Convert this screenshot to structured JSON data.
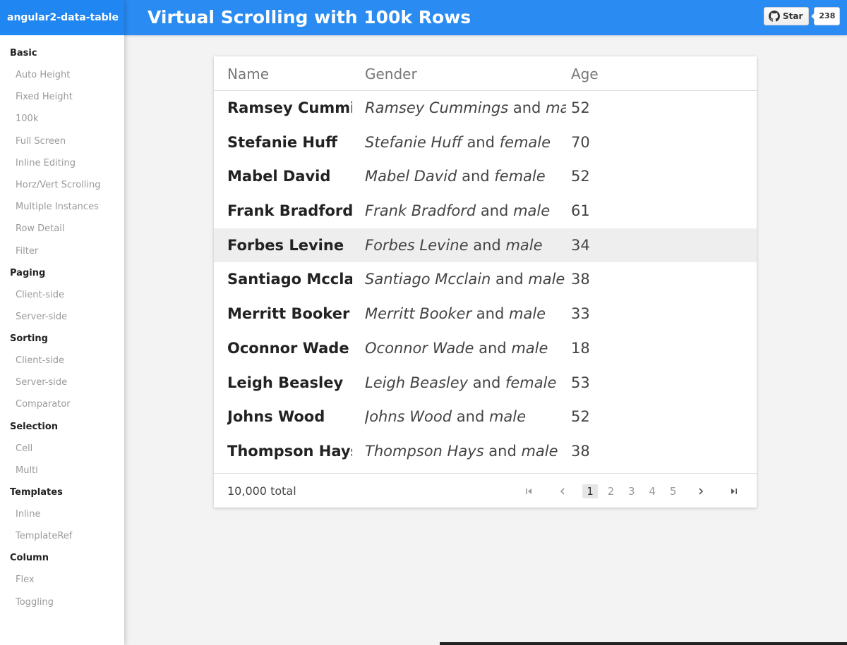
{
  "sidebar": {
    "brand": "angular2-data-table",
    "sections": [
      {
        "title": "Basic",
        "items": [
          "Auto Height",
          "Fixed Height",
          "100k",
          "Full Screen",
          "Inline Editing",
          "Horz/Vert Scrolling",
          "Multiple Instances",
          "Row Detail",
          "Filter"
        ]
      },
      {
        "title": "Paging",
        "items": [
          "Client-side",
          "Server-side"
        ]
      },
      {
        "title": "Sorting",
        "items": [
          "Client-side",
          "Server-side",
          "Comparator"
        ]
      },
      {
        "title": "Selection",
        "items": [
          "Cell",
          "Multi"
        ]
      },
      {
        "title": "Templates",
        "items": [
          "Inline",
          "TemplateRef"
        ]
      },
      {
        "title": "Column",
        "items": [
          "Flex",
          "Toggling"
        ]
      }
    ]
  },
  "header": {
    "title": "Virtual Scrolling with 100k Rows",
    "github": {
      "star_label": "Star",
      "count": "238",
      "icon": "github-icon"
    }
  },
  "table": {
    "columns": [
      "Name",
      "Gender",
      "Age"
    ],
    "gender_joiner": "and",
    "hovered_row": 4,
    "rows": [
      {
        "name": "Ramsey Cummings",
        "gender": "male",
        "age": "52"
      },
      {
        "name": "Stefanie Huff",
        "gender": "female",
        "age": "70"
      },
      {
        "name": "Mabel David",
        "gender": "female",
        "age": "52"
      },
      {
        "name": "Frank Bradford",
        "gender": "male",
        "age": "61"
      },
      {
        "name": "Forbes Levine",
        "gender": "male",
        "age": "34"
      },
      {
        "name": "Santiago Mcclain",
        "gender": "male",
        "age": "38"
      },
      {
        "name": "Merritt Booker",
        "gender": "male",
        "age": "33"
      },
      {
        "name": "Oconnor Wade",
        "gender": "male",
        "age": "18"
      },
      {
        "name": "Leigh Beasley",
        "gender": "female",
        "age": "53"
      },
      {
        "name": "Johns Wood",
        "gender": "male",
        "age": "52"
      },
      {
        "name": "Thompson Hays",
        "gender": "male",
        "age": "38"
      }
    ],
    "footer": {
      "total": "10,000 total",
      "pages": [
        "1",
        "2",
        "3",
        "4",
        "5"
      ],
      "active_page": "1",
      "icons": {
        "first": "first-page-icon",
        "prev": "prev-page-icon",
        "next": "next-page-icon",
        "last": "last-page-icon"
      }
    }
  }
}
